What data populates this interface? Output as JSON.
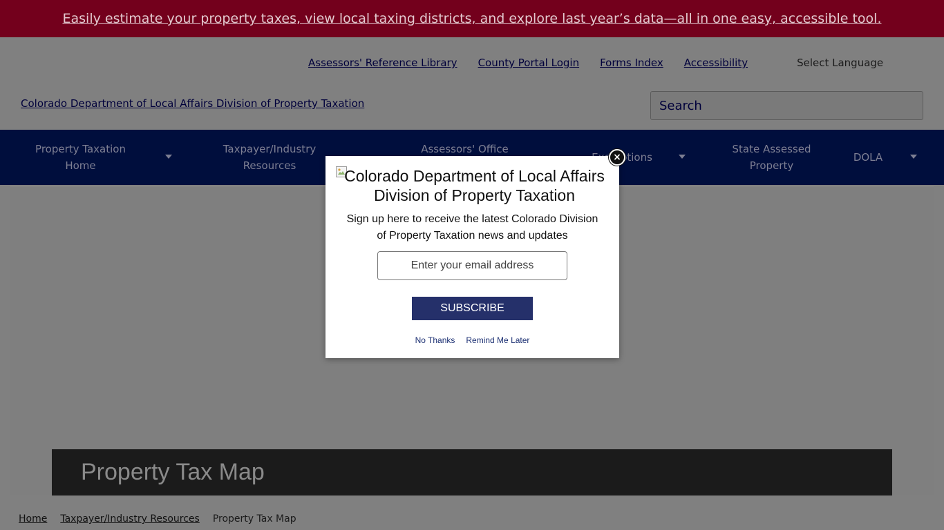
{
  "banner": {
    "text": "Easily estimate your property taxes, view local taxing districts, and explore last year’s data—all in one easy, accessible tool."
  },
  "utility": {
    "links": [
      "Assessors' Reference Library",
      "County Portal Login",
      "Forms Index",
      "Accessibility"
    ],
    "language": "Select Language"
  },
  "logo": {
    "alt": "Colorado Department of Local Affairs Division of Property Taxation"
  },
  "search": {
    "placeholder": "Search"
  },
  "nav": {
    "items": [
      {
        "line1": "Property Taxation",
        "line2": "Home"
      },
      {
        "line1": "Taxpayer/Industry",
        "line2": "Resources"
      },
      {
        "line1": "Assessors' Office",
        "line2": ""
      },
      {
        "line1": "Exemptions",
        "line2": ""
      },
      {
        "line1": "State Assessed",
        "line2": "Property"
      },
      {
        "line1": "DOLA",
        "line2": ""
      }
    ]
  },
  "hero": {
    "title": "Property Tax Map"
  },
  "breadcrumb": {
    "home": "Home",
    "section": "Taxpayer/Industry Resources",
    "current": "Property Tax Map"
  },
  "modal": {
    "close_glyph": "×",
    "title": "Colorado Department of Local Affairs Division of Property Taxation",
    "text": "Sign up here to receive the latest Colorado Division of Property Taxation news and updates",
    "email_placeholder": "Enter your email address",
    "subscribe": "SUBSCRIBE",
    "no_thanks": "No Thanks",
    "remind_later": "Remind Me Later"
  }
}
